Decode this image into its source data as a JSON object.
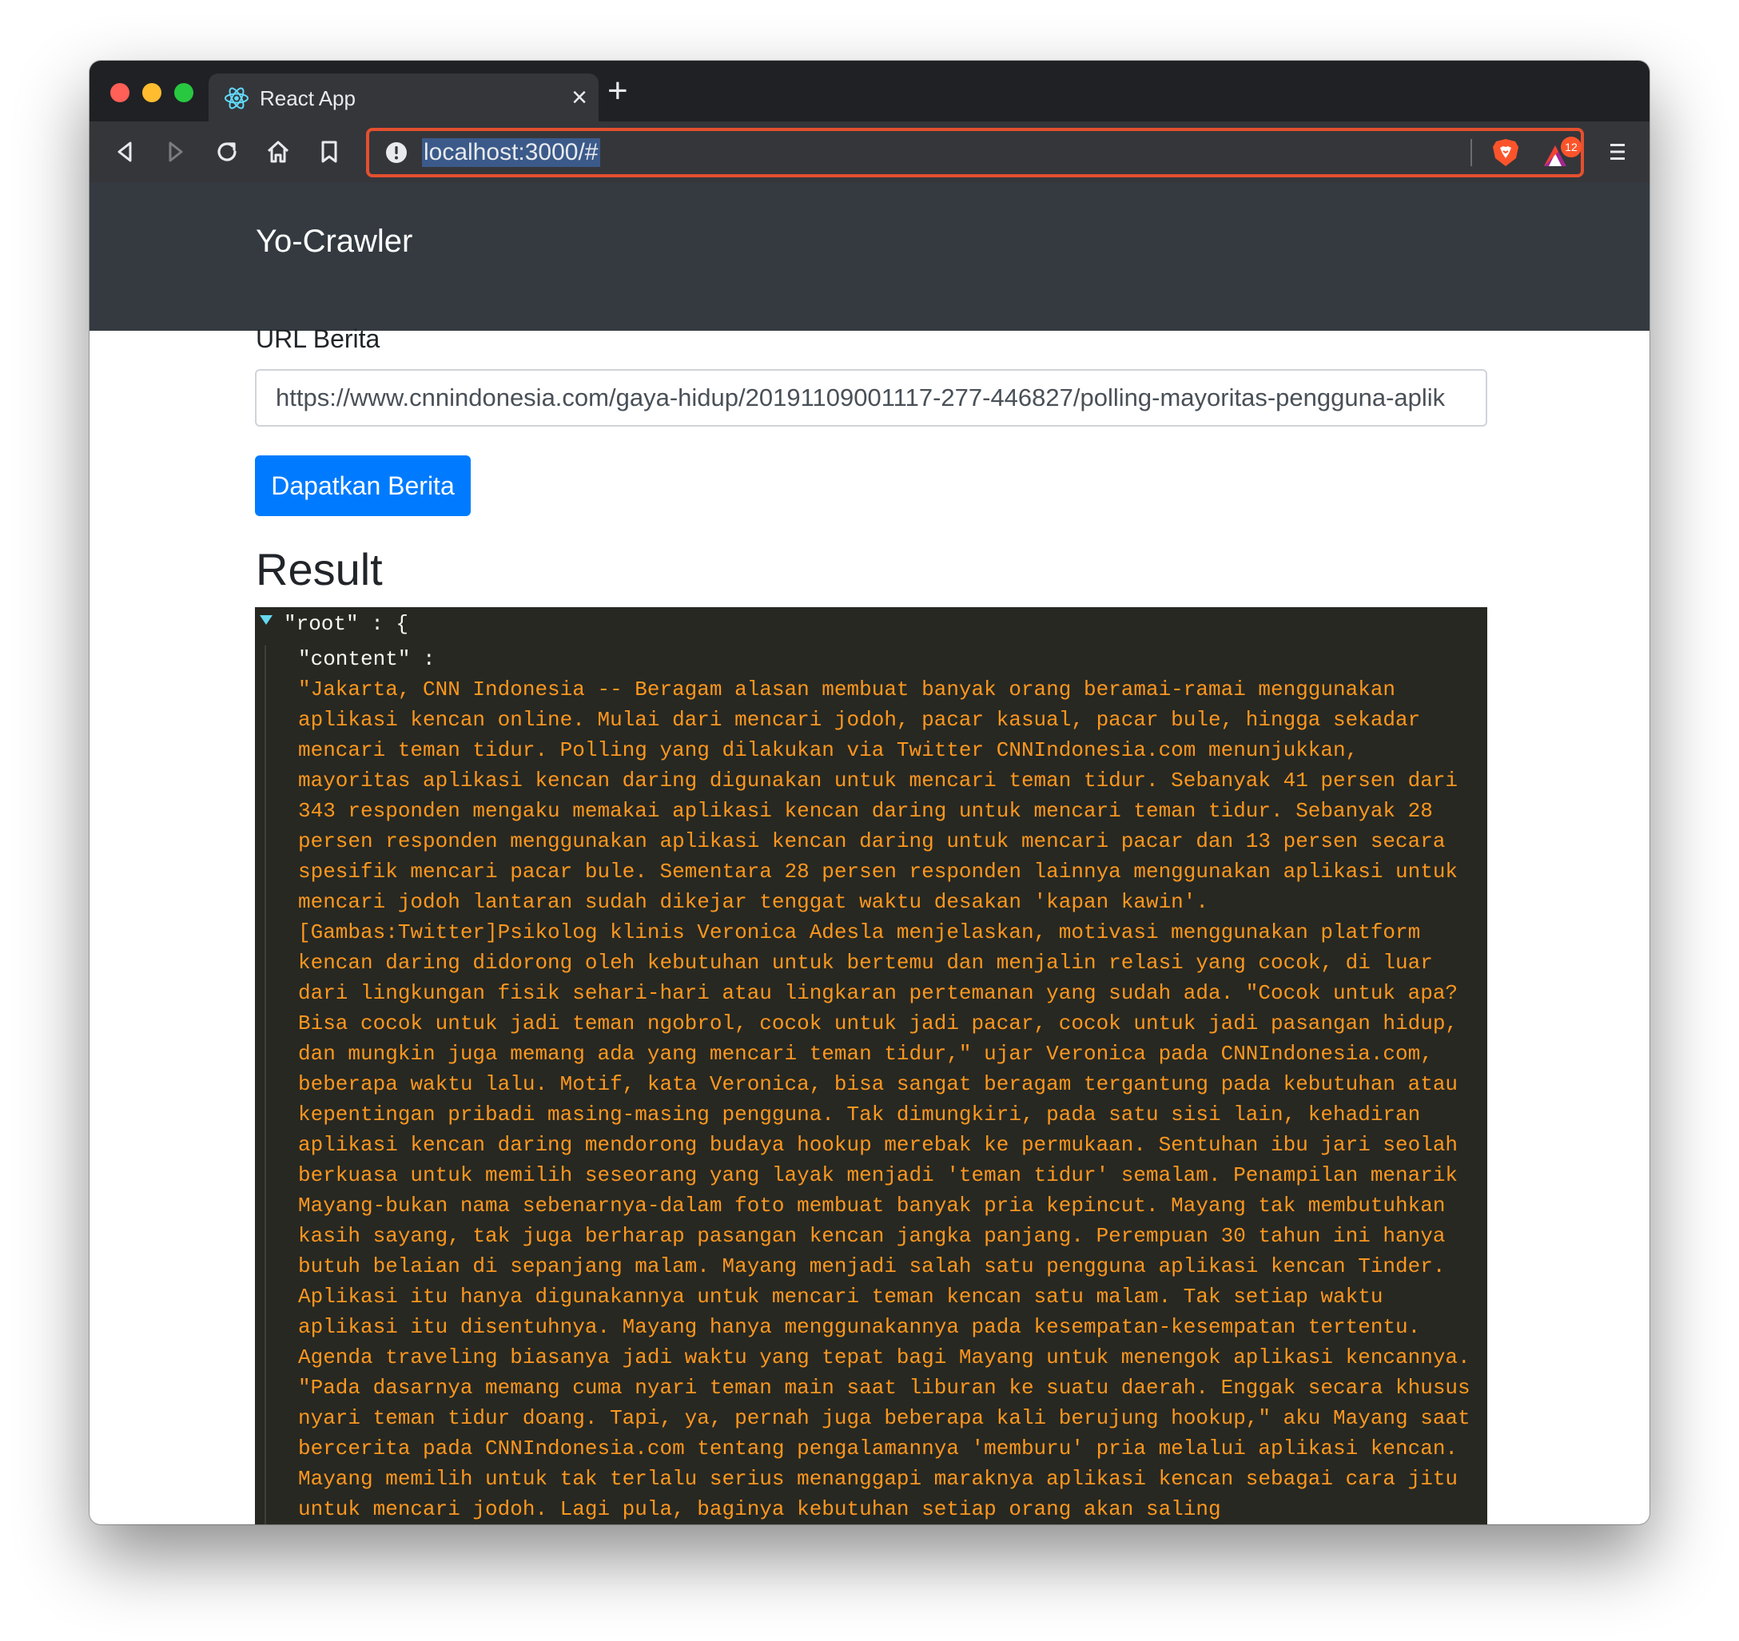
{
  "browser": {
    "tab_title": "React App",
    "tab_close": "×",
    "new_tab": "+",
    "url": "localhost:3000/#",
    "rewards_badge": "12",
    "icons": [
      "back-icon",
      "forward-icon",
      "reload-icon",
      "home-icon",
      "bookmark-icon",
      "info-icon",
      "brave-shields-icon",
      "brave-rewards-icon",
      "menu-icon"
    ]
  },
  "navbar": {
    "brand": "Yo-Crawler"
  },
  "form": {
    "label": "URL Berita",
    "url_value": "https://www.cnnindonesia.com/gaya-hidup/20191109001117-277-446827/polling-mayoritas-pengguna-aplik",
    "submit_label": "Dapatkan Berita"
  },
  "result": {
    "heading": "Result",
    "root_line": "\"root\" : {",
    "content_key": "\"content\" :",
    "content_value": "\"Jakarta, CNN Indonesia -- Beragam alasan membuat banyak orang beramai-ramai menggunakan aplikasi kencan online. Mulai dari mencari jodoh, pacar kasual, pacar bule, hingga sekadar mencari teman tidur. Polling yang dilakukan via Twitter CNNIndonesia.com menunjukkan, mayoritas aplikasi kencan daring digunakan untuk mencari teman tidur. Sebanyak 41 persen dari 343 responden mengaku memakai aplikasi kencan daring untuk mencari teman tidur. Sebanyak 28 persen responden menggunakan aplikasi kencan daring untuk mencari pacar dan 13 persen secara spesifik mencari pacar bule. Sementara 28 persen responden lainnya menggunakan aplikasi untuk mencari jodoh lantaran sudah dikejar tenggat waktu desakan 'kapan kawin'. [Gambas:Twitter]Psikolog klinis Veronica Adesla menjelaskan, motivasi menggunakan platform kencan daring didorong oleh kebutuhan untuk bertemu dan menjalin relasi yang cocok, di luar dari lingkungan fisik sehari-hari atau lingkaran pertemanan yang sudah ada. \"Cocok untuk apa? Bisa cocok untuk jadi teman ngobrol, cocok untuk jadi pacar, cocok untuk jadi pasangan hidup, dan mungkin juga memang ada yang mencari teman tidur,\" ujar Veronica pada CNNIndonesia.com, beberapa waktu lalu. Motif, kata Veronica, bisa sangat beragam tergantung pada kebutuhan atau kepentingan pribadi masing-masing pengguna. Tak dimungkiri, pada satu sisi lain, kehadiran aplikasi kencan daring mendorong budaya hookup merebak ke permukaan. Sentuhan ibu jari seolah berkuasa untuk memilih seseorang yang layak menjadi 'teman tidur' semalam. Penampilan menarik Mayang-bukan nama sebenarnya-dalam foto membuat banyak pria kepincut. Mayang tak membutuhkan kasih sayang, tak juga berharap pasangan kencan jangka panjang. Perempuan 30 tahun ini hanya butuh belaian di sepanjang malam. Mayang menjadi salah satu pengguna aplikasi kencan Tinder. Aplikasi itu hanya digunakannya untuk mencari teman kencan satu malam. Tak setiap waktu aplikasi itu disentuhnya. Mayang hanya menggunakannya pada kesempatan-kesempatan tertentu. Agenda traveling biasanya jadi waktu yang tepat bagi Mayang untuk menengok aplikasi kencannya. \"Pada dasarnya memang cuma nyari teman main saat liburan ke suatu daerah. Enggak secara khusus nyari teman tidur doang. Tapi, ya, pernah juga beberapa kali berujung hookup,\" aku Mayang saat bercerita pada CNNIndonesia.com tentang pengalamannya 'memburu' pria melalui aplikasi kencan. Mayang memilih untuk tak terlalu serius menanggapi maraknya aplikasi kencan sebagai cara jitu untuk mencari jodoh. Lagi pula, baginya kebutuhan setiap orang akan saling"
  },
  "colors": {
    "chrome_dark": "#202124",
    "toolbar": "#35363a",
    "omnibox_border": "#e4502e",
    "navbar": "#343a40",
    "primary": "#007bff",
    "json_bg": "#272822",
    "json_string": "#fd971f"
  }
}
